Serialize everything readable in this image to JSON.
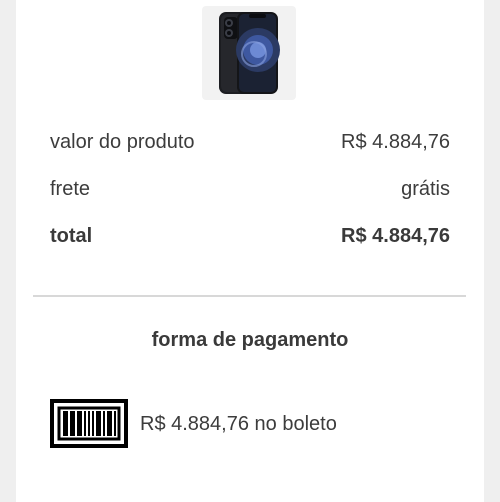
{
  "product": {
    "image_icon": "phone-image"
  },
  "summary": {
    "product_value_label": "valor do produto",
    "product_value": "R$ 4.884,76",
    "shipping_label": "frete",
    "shipping_value": "grátis",
    "total_label": "total",
    "total_value": "R$ 4.884,76"
  },
  "payment": {
    "title": "forma de pagamento",
    "boleto_icon": "barcode-icon",
    "boleto_text": "R$ 4.884,76 no boleto"
  }
}
